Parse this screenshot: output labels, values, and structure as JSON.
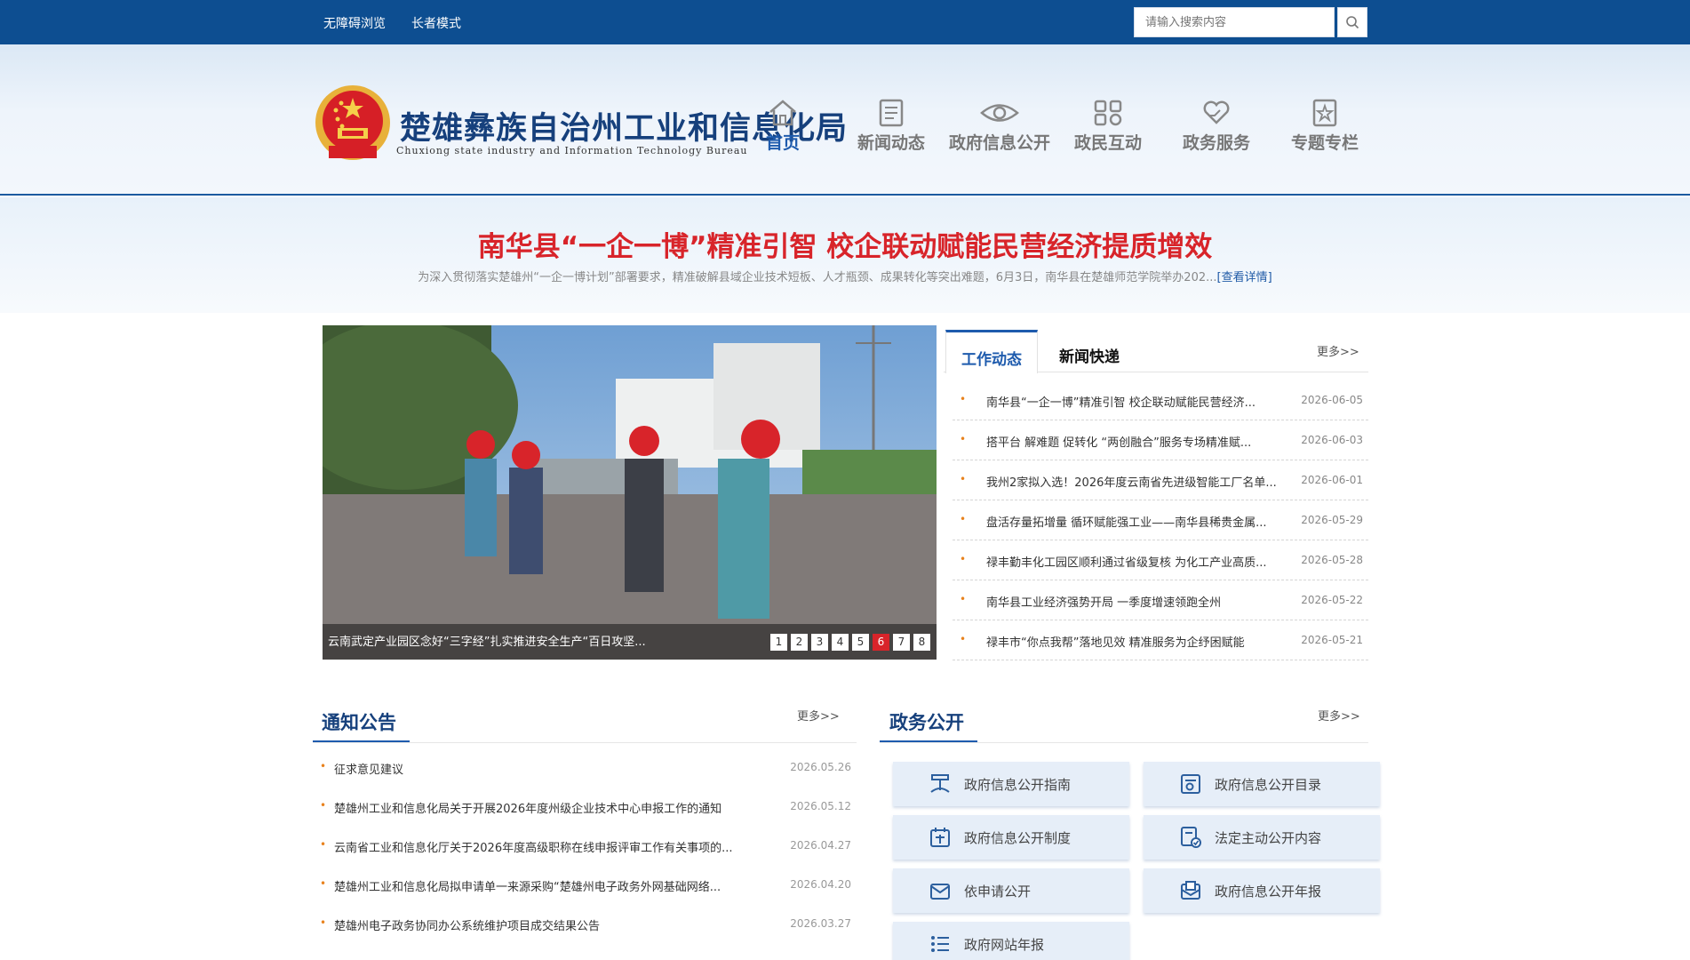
{
  "topbar": {
    "accessibility_label": "无障碍浏览",
    "elder_label": "长者模式",
    "search_placeholder": "请输入搜索内容"
  },
  "header": {
    "title": "楚雄彝族自治州工业和信息化局",
    "subtitle": "Chuxiong state industry and Information Technology Bureau"
  },
  "nav": [
    {
      "label": "首页",
      "icon": "home-icon",
      "active": true
    },
    {
      "label": "新闻动态",
      "icon": "newspaper-icon"
    },
    {
      "label": "政府信息公开",
      "icon": "eye-icon"
    },
    {
      "label": "政民互动",
      "icon": "interaction-icon"
    },
    {
      "label": "政务服务",
      "icon": "heart-hand-icon"
    },
    {
      "label": "专题专栏",
      "icon": "star-doc-icon"
    }
  ],
  "headline": {
    "title": "南华县“一企一博”精准引智 校企联动赋能民营经济提质增效",
    "summary": "为深入贯彻落实楚雄州“一企一博计划”部署要求，精准破解县域企业技术短板、人才瓶颈、成果转化等突出难题，6月3日，南华县在楚雄师范学院举办202...",
    "more": "[查看详情]"
  },
  "slider": {
    "caption": "云南武定产业园区念好“三字经”扎实推进安全生产“百日攻坚...",
    "dots": [
      "1",
      "2",
      "3",
      "4",
      "5",
      "6",
      "7",
      "8"
    ],
    "active_dot": "6"
  },
  "news": {
    "tab_work": "工作动态",
    "tab_news": "新闻快递",
    "more": "更多>>",
    "items": [
      {
        "title": "南华县“一企一博”精准引智 校企联动赋能民营经济...",
        "date": "2026-06-05"
      },
      {
        "title": "搭平台 解难题 促转化 “两创融合”服务专场精准赋...",
        "date": "2026-06-03"
      },
      {
        "title": "我州2家拟入选！2026年度云南省先进级智能工厂名单...",
        "date": "2026-06-01"
      },
      {
        "title": "盘活存量拓增量 循环赋能强工业——南华县稀贵金属...",
        "date": "2026-05-29"
      },
      {
        "title": "禄丰勤丰化工园区顺利通过省级复核 为化工产业高质...",
        "date": "2026-05-28"
      },
      {
        "title": "南华县工业经济强势开局 一季度增速领跑全州",
        "date": "2026-05-22"
      },
      {
        "title": "禄丰市“你点我帮”落地见效 精准服务为企纾困赋能",
        "date": "2026-05-21"
      }
    ]
  },
  "notices": {
    "title": "通知公告",
    "more": "更多>>",
    "items": [
      {
        "title": "征求意见建议",
        "date": "2026.05.26"
      },
      {
        "title": "楚雄州工业和信息化局关于开展2026年度州级企业技术中心申报工作的通知",
        "date": "2026.05.12"
      },
      {
        "title": "云南省工业和信息化厅关于2026年度高级职称在线申报评审工作有关事项的...",
        "date": "2026.04.27"
      },
      {
        "title": "楚雄州工业和信息化局拟申请单一来源采购“楚雄州电子政务外网基础网络...",
        "date": "2026.04.20"
      },
      {
        "title": "楚雄州电子政务协同办公系统维护项目成交结果公告",
        "date": "2026.03.27"
      }
    ]
  },
  "gov": {
    "title": "政务公开",
    "more": "更多>>",
    "buttons": [
      {
        "label": "政府信息公开指南",
        "icon": "guide-icon"
      },
      {
        "label": "政府信息公开目录",
        "icon": "catalog-icon"
      },
      {
        "label": "政府信息公开制度",
        "icon": "calendar-icon"
      },
      {
        "label": "法定主动公开内容",
        "icon": "doc-check-icon"
      },
      {
        "label": "依申请公开",
        "icon": "envelope-icon"
      },
      {
        "label": "政府信息公开年报",
        "icon": "report-icon"
      },
      {
        "label": "政府网站年报",
        "icon": "list-icon"
      }
    ]
  },
  "colors": {
    "topbar": "#0d4e91",
    "primary": "#1e5bad",
    "headline": "#d8242a",
    "bullet": "#e8821e"
  }
}
